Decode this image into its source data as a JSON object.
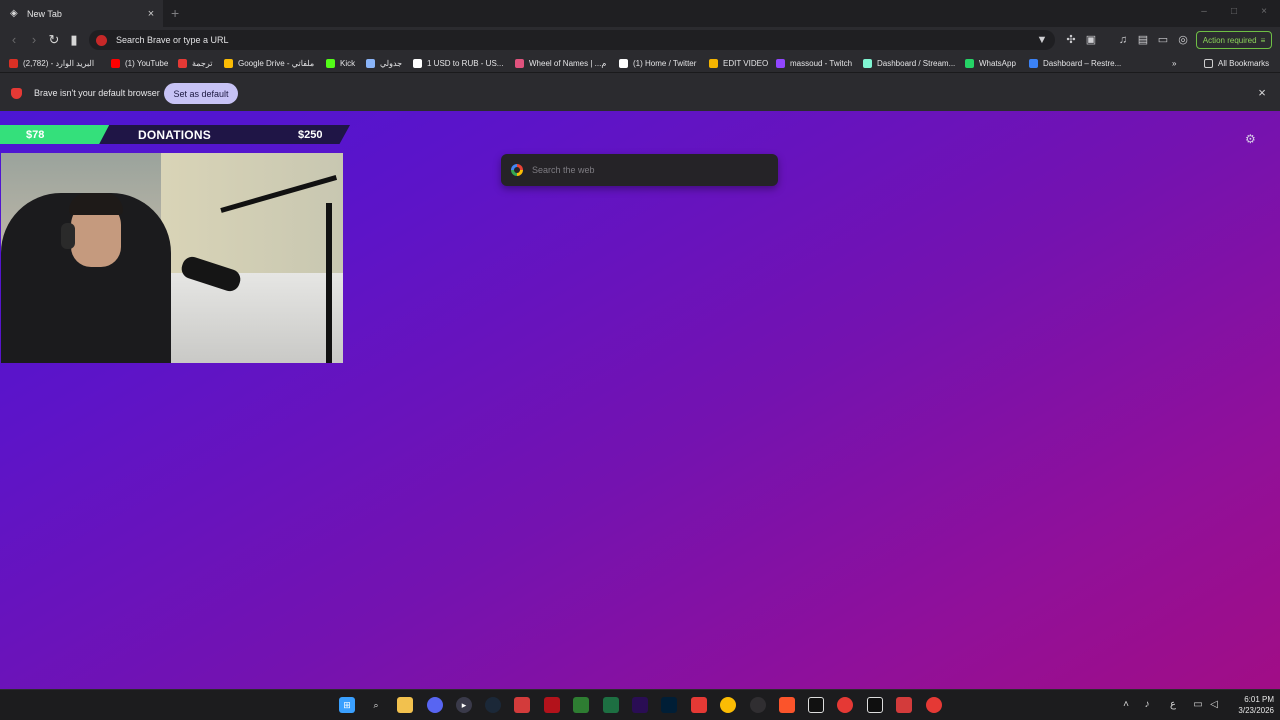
{
  "browser": {
    "tab": {
      "title": "New Tab",
      "icon": "brave-tab-icon",
      "close": "×"
    },
    "new_tab": "+",
    "window_controls": [
      "–",
      "□",
      "×"
    ],
    "omnibox": {
      "placeholder": "Search Brave or type a URL"
    },
    "action_required": "Action required",
    "bookmarks": [
      {
        "label": "البريد الوارد - (2,782)",
        "icon": "gmail-icon",
        "color": "#d93025"
      },
      {
        "label": "(1) YouTube",
        "icon": "youtube-icon",
        "color": "#ff0000"
      },
      {
        "label": "ترجمة",
        "icon": "translate-icon",
        "color": "#e53935"
      },
      {
        "label": "Google Drive - ملفاتي",
        "icon": "google-drive-icon",
        "color": "#fbbc04"
      },
      {
        "label": "Kick",
        "icon": "kick-icon",
        "color": "#53fc18"
      },
      {
        "label": "جدولي",
        "icon": "schedule-icon",
        "color": "#8ab4f8"
      },
      {
        "label": "1 USD to RUB - US...",
        "icon": "xe-icon",
        "color": "#ffffff"
      },
      {
        "label": "Wheel of Names | ...م",
        "icon": "wheel-icon",
        "color": "#e0527d"
      },
      {
        "label": "(1) Home / Twitter",
        "icon": "x-icon",
        "color": "#ffffff"
      },
      {
        "label": "EDIT VIDEO",
        "icon": "edit-video-icon",
        "color": "#f4b400"
      },
      {
        "label": "massoud - Twitch",
        "icon": "twitch-icon",
        "color": "#9146ff"
      },
      {
        "label": "Dashboard / Stream...",
        "icon": "streamlabs-icon",
        "color": "#80f5d2"
      },
      {
        "label": "WhatsApp",
        "icon": "whatsapp-icon",
        "color": "#25d366"
      },
      {
        "label": "Dashboard – Restre...",
        "icon": "restream-icon",
        "color": "#3b82f6"
      }
    ],
    "bookmarks_overflow": "»",
    "all_bookmarks": "All Bookmarks",
    "infobar": {
      "text": "Brave isn't your default browser",
      "button": "Set as default",
      "close": "×"
    }
  },
  "page": {
    "search_placeholder": "Search the web",
    "settings_icon": "gear-icon"
  },
  "overlay": {
    "donations": {
      "current": "$78",
      "label": "DONATIONS",
      "goal": "$250",
      "current_value": 78,
      "goal_value": 250,
      "fill_color": "#34e07b",
      "bar_color": "#1f1546"
    }
  },
  "taskbar": {
    "apps": [
      {
        "name": "windows-start-icon",
        "color": "#3aa0ff"
      },
      {
        "name": "search-icon",
        "color": "#1c1c1e"
      },
      {
        "name": "file-explorer-icon",
        "color": "#f2c14e"
      },
      {
        "name": "discord-icon",
        "color": "#5865f2"
      },
      {
        "name": "media-player-icon",
        "color": "#3a3a4a"
      },
      {
        "name": "steam-icon",
        "color": "#1b2838"
      },
      {
        "name": "app-eu-icon",
        "color": "#d33b3b"
      },
      {
        "name": "app-red-icon",
        "color": "#b3121b"
      },
      {
        "name": "app-green-icon",
        "color": "#2e7d32"
      },
      {
        "name": "excel-icon",
        "color": "#1d6f42"
      },
      {
        "name": "premiere-icon",
        "color": "#2a0d54"
      },
      {
        "name": "photoshop-icon",
        "color": "#001e36"
      },
      {
        "name": "app-red2-icon",
        "color": "#e53935"
      },
      {
        "name": "chrome-icon",
        "color": "#fbbc04"
      },
      {
        "name": "obs-icon",
        "color": "#302e31"
      },
      {
        "name": "brave-icon",
        "color": "#fb542b"
      },
      {
        "name": "capcut-icon",
        "color": "#111111"
      },
      {
        "name": "app-cc-icon",
        "color": "#e53935"
      },
      {
        "name": "app-store-icon",
        "color": "#0f0f0f"
      },
      {
        "name": "app-eu2-icon",
        "color": "#d33b3b"
      },
      {
        "name": "app-cc2-icon",
        "color": "#e53935"
      }
    ],
    "tray_input": "ع",
    "clock_time": "6:01 PM",
    "clock_date": "3/23/2026"
  }
}
